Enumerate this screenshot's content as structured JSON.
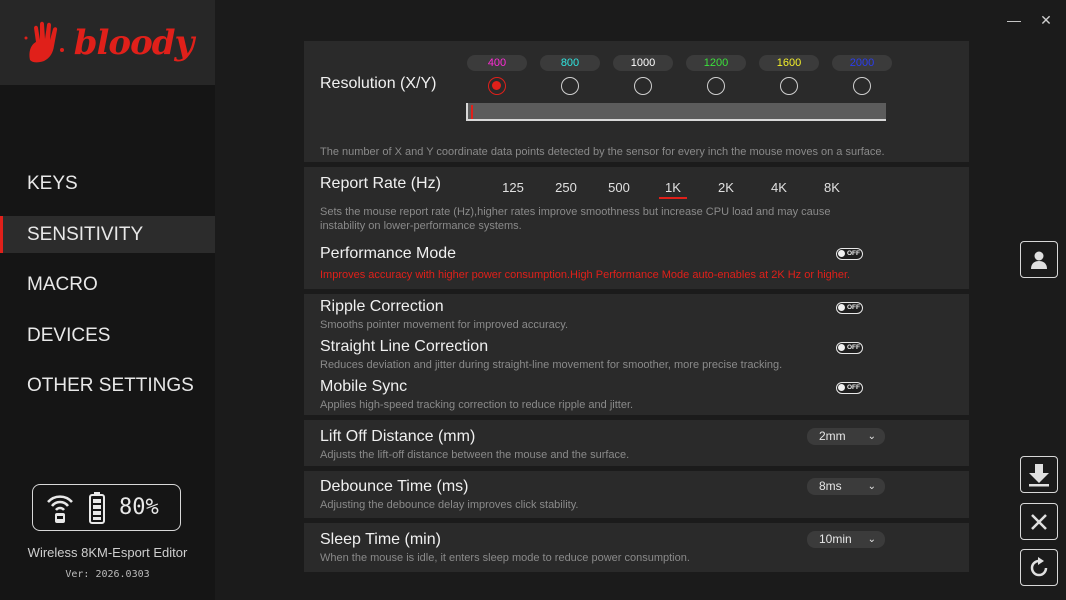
{
  "app": {
    "logo_text": "bloody",
    "editor_name": "Wireless 8KM-Esport Editor",
    "version": "Ver: 2026.0303",
    "battery_percent": "80%"
  },
  "nav": {
    "items": [
      {
        "label": "KEYS"
      },
      {
        "label": "SENSITIVITY"
      },
      {
        "label": "MACRO"
      },
      {
        "label": "DEVICES"
      },
      {
        "label": "OTHER SETTINGS"
      }
    ],
    "active": "SENSITIVITY"
  },
  "window": {
    "minimize": "—",
    "close": "✕"
  },
  "resolution": {
    "title": "Resolution (X/Y)",
    "levels": [
      {
        "value": "400",
        "color": "#ff2bd6"
      },
      {
        "value": "800",
        "color": "#2fe6e0"
      },
      {
        "value": "1000",
        "color": "#ffffff"
      },
      {
        "value": "1200",
        "color": "#3be03b"
      },
      {
        "value": "1600",
        "color": "#f4f02a"
      },
      {
        "value": "2000",
        "color": "#2a3df0"
      }
    ],
    "selected": "400",
    "description": "The number of X and Y coordinate data points detected by the sensor for every inch the mouse moves on a surface."
  },
  "report_rate": {
    "title": "Report Rate (Hz)",
    "options": [
      "125",
      "250",
      "500",
      "1K",
      "2K",
      "4K",
      "8K"
    ],
    "selected": "1K",
    "description_1": "Sets the mouse report rate (Hz),higher rates improve smoothness but increase CPU load and may cause",
    "description_2": "instability on lower-performance systems."
  },
  "performance_mode": {
    "title": "Performance Mode",
    "toggle": "OFF",
    "description": "Improves accuracy with higher power consumption.High Performance Mode auto-enables at 2K Hz or higher."
  },
  "ripple_correction": {
    "title": "Ripple Correction",
    "toggle": "OFF",
    "description": "Smooths pointer movement for improved accuracy."
  },
  "straight_line_correction": {
    "title": "Straight Line Correction",
    "toggle": "OFF",
    "description": "Reduces deviation and jitter during straight-line movement for smoother, more precise tracking."
  },
  "mobile_sync": {
    "title": "Mobile Sync",
    "toggle": "OFF",
    "description": "Applies high-speed tracking correction to reduce ripple and jitter."
  },
  "lift_off": {
    "title": "Lift Off Distance (mm)",
    "value": "2mm",
    "description": "Adjusts the lift-off distance between the mouse and the surface."
  },
  "debounce": {
    "title": "Debounce Time (ms)",
    "value": "8ms",
    "description": "Adjusting the debounce delay improves click stability."
  },
  "sleep": {
    "title": "Sleep Time (min)",
    "value": "10min",
    "description": "When the mouse is idle, it enters sleep mode to reduce power consumption."
  },
  "icons": {
    "user": "user-icon",
    "download": "download-arrow-icon",
    "cancel": "cancel-x-icon",
    "reset": "refresh-icon"
  },
  "colors": {
    "accent": "#e0201a"
  }
}
